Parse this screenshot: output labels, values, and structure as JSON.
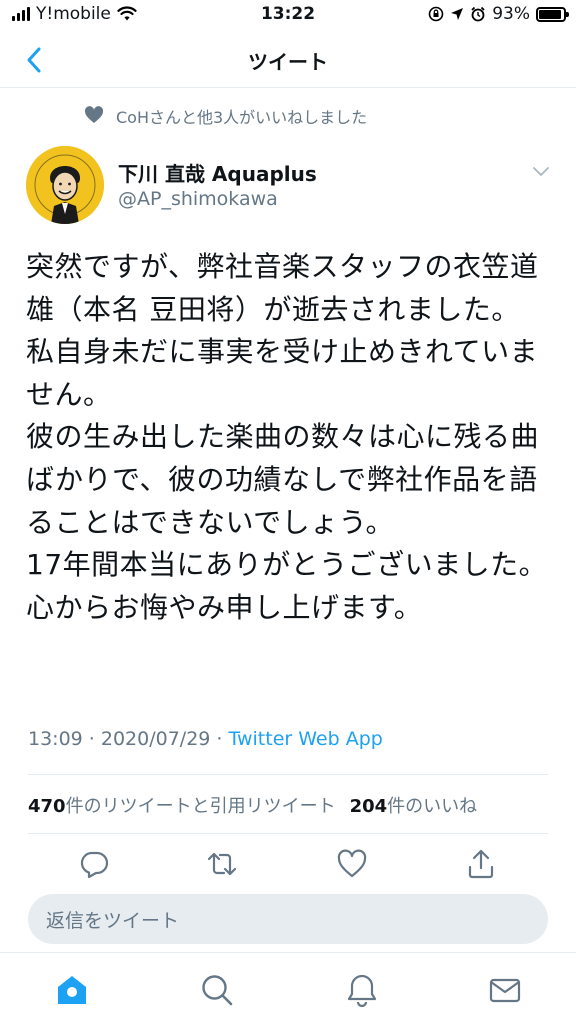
{
  "status_bar": {
    "carrier": "Y!mobile",
    "time": "13:22",
    "battery_percent": "93%",
    "battery_level": 0.93
  },
  "nav": {
    "title": "ツイート"
  },
  "social_context": "CoHさんと他3人がいいねしました",
  "author": {
    "display_name": "下川 直哉 Aquaplus",
    "handle": "@AP_shimokawa"
  },
  "tweet": {
    "text": "突然ですが、弊社音楽スタッフの衣笠道雄（本名 豆田将）が逝去されました。\n私自身未だに事実を受け止めきれていません。\n彼の生み出した楽曲の数々は心に残る曲ばかりで、彼の功績なしで弊社作品を語ることはできないでしょう。\n17年間本当にありがとうございました。心からお悔やみ申し上げます。",
    "time": "13:09 · 2020/07/29 · ",
    "source": "Twitter Web App"
  },
  "stats": {
    "retweets_count": "470",
    "retweets_label": "件のリツイートと引用リツイート",
    "likes_count": "204",
    "likes_label": "件のいいね"
  },
  "reply": {
    "placeholder": "返信をツイート"
  },
  "icons": {
    "back": "chevron-left-icon",
    "caret": "chevron-down-icon",
    "reply": "reply-icon",
    "retweet": "retweet-icon",
    "like": "heart-icon",
    "share": "share-icon",
    "home": "home-icon",
    "search": "search-icon",
    "notifications": "bell-icon",
    "messages": "mail-icon"
  },
  "colors": {
    "accent": "#1da1f2",
    "muted": "#657786",
    "divider": "#e6ecf0"
  }
}
